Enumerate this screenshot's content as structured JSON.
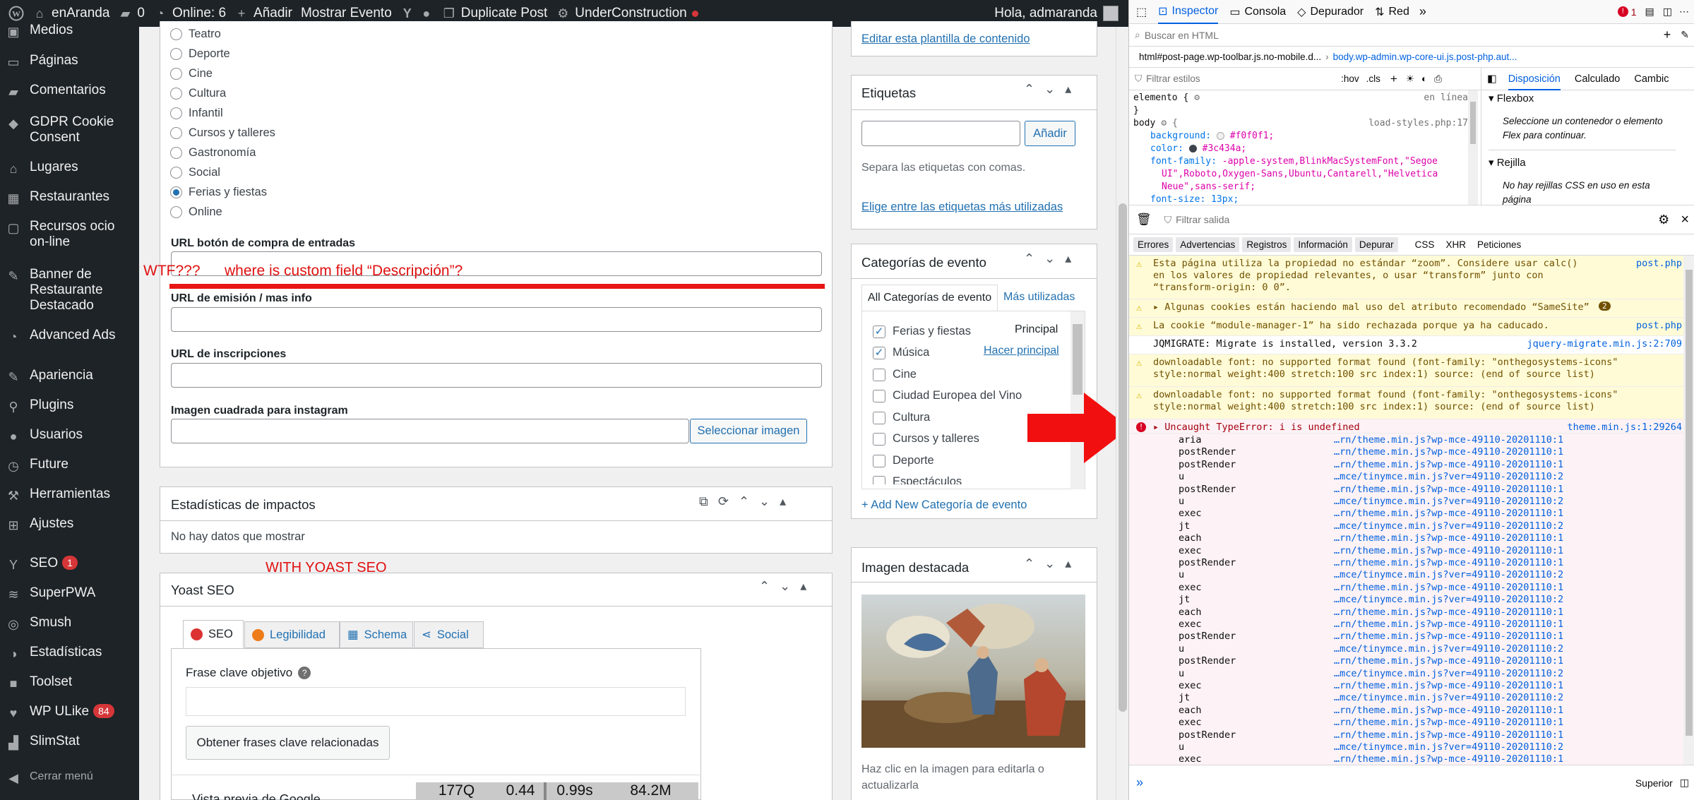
{
  "adminbar": {
    "site": "enAranda",
    "comments": "0",
    "online": "Online: 6",
    "add": "Añadir",
    "show_event": "Mostrar Evento",
    "duplicate": "Duplicate Post",
    "under_construction": "UnderConstruction",
    "greeting": "Hola, admaranda"
  },
  "sidebar": {
    "items": [
      {
        "label": "Medios",
        "icon": "media-icon"
      },
      {
        "label": "Páginas",
        "icon": "pages-icon"
      },
      {
        "label": "Comentarios",
        "icon": "comments-icon"
      },
      {
        "label": "GDPR Cookie Consent",
        "icon": "cookie-icon"
      },
      {
        "label": "Lugares",
        "icon": "places-icon"
      },
      {
        "label": "Restaurantes",
        "icon": "restaurant-icon"
      },
      {
        "label": "Recursos ocio on-line",
        "icon": "resources-icon"
      },
      {
        "label": "Banner de Restaurante Destacado",
        "icon": "banner-icon"
      },
      {
        "label": "Advanced Ads",
        "icon": "ads-icon"
      },
      {
        "label": "Apariencia",
        "icon": "appearance-icon"
      },
      {
        "label": "Plugins",
        "icon": "plugins-icon"
      },
      {
        "label": "Usuarios",
        "icon": "users-icon"
      },
      {
        "label": "Future",
        "icon": "future-icon"
      },
      {
        "label": "Herramientas",
        "icon": "tools-icon"
      },
      {
        "label": "Ajustes",
        "icon": "settings-icon"
      },
      {
        "label": "SEO",
        "icon": "yoast-icon",
        "badge": "1"
      },
      {
        "label": "SuperPWA",
        "icon": "pwa-icon"
      },
      {
        "label": "Smush",
        "icon": "smush-icon"
      },
      {
        "label": "Estadísticas",
        "icon": "stats-icon"
      },
      {
        "label": "Toolset",
        "icon": "toolset-icon"
      },
      {
        "label": "WP ULike",
        "icon": "ulike-icon",
        "badge": "84"
      },
      {
        "label": "SlimStat",
        "icon": "slimstat-icon"
      },
      {
        "label": "Cerrar menú",
        "icon": "collapse-icon"
      }
    ]
  },
  "radios": [
    "Teatro",
    "Deporte",
    "Cine",
    "Cultura",
    "Infantil",
    "Cursos y talleres",
    "Gastronomía",
    "Social",
    "Ferias y fiestas",
    "Online"
  ],
  "fields": {
    "buy_url": "URL botón de compra de entradas",
    "emission_url": "URL de emisión / mas info",
    "signup_url": "URL de inscripciones",
    "insta_image": "Imagen cuadrada para instagram",
    "select_image": "Seleccionar imagen"
  },
  "annotations": {
    "wtf": "WTF???",
    "missing": "where is custom field “Descripción”?",
    "yoast": "WITH YOAST SEO"
  },
  "stats": {
    "title": "Estadísticas de impactos",
    "empty": "No hay datos que mostrar"
  },
  "yoast": {
    "title": "Yoast SEO",
    "tabs": [
      "SEO",
      "Legibilidad",
      "Schema",
      "Social"
    ],
    "focus_label": "Frase clave objetivo",
    "related_button": "Obtener frases clave relacionadas",
    "preview": "Vista previa de Google",
    "metrics": [
      "177Q",
      "0.44",
      "0.99s",
      "84.2M"
    ]
  },
  "right": {
    "edit_template": "Editar esta plantilla de contenido",
    "tags_title": "Etiquetas",
    "add_button": "Añadir",
    "tags_hint": "Separa las etiquetas con comas.",
    "tags_link": "Elige entre las etiquetas más utilizadas",
    "cat_title": "Categorías de evento",
    "cat_tab_all": "All Categorías de evento",
    "cat_tab_used": "Más utilizadas",
    "categories": [
      {
        "label": "Ferias y fiestas",
        "checked": true,
        "extra": "Principal"
      },
      {
        "label": "Música",
        "checked": true,
        "extra": "Hacer principal"
      },
      {
        "label": "Cine",
        "checked": false
      },
      {
        "label": "Ciudad Europea del Vino",
        "checked": false
      },
      {
        "label": "Cultura",
        "checked": false
      },
      {
        "label": "Cursos y talleres",
        "checked": false
      },
      {
        "label": "Deporte",
        "checked": false
      },
      {
        "label": "Espectáculos",
        "checked": false
      }
    ],
    "add_cat": "+ Add New Categoría de evento",
    "featured_title": "Imagen destacada",
    "featured_hint": "Haz clic en la imagen para editarla o actualizarla"
  },
  "devtools": {
    "tabs": [
      "Inspector",
      "Consola",
      "Depurador",
      "Red"
    ],
    "error_count": "1",
    "search_html": "Buscar en HTML",
    "breadcrumb_left": "html#post-page.wp-toolbar.js.no-mobile.d...",
    "breadcrumb_right": "body.wp-admin.wp-core-ui.js.post-php.aut...",
    "filter_styles": "Filtrar estilos",
    "hov": ":hov",
    "cls": ".cls",
    "layout_tabs": [
      "Disposición",
      "Calculado",
      "Cambic"
    ],
    "css": {
      "rule1": "elemento {",
      "inline": "en línea",
      "close": "}",
      "rule2": "body",
      "source": "load-styles.php:17",
      "bg_prop": "background:",
      "bg_val": "#f0f0f1;",
      "color_prop": "color:",
      "color_val": "#3c434a;",
      "ff_prop": "font-family:",
      "ff_val1": "-apple-system,BlinkMacSystemFont,\"Segoe",
      "ff_val2": "UI\",Roboto,Oxygen-Sans,Ubuntu,Cantarell,\"Helvetica",
      "ff_val3": "Neue\",sans-serif;",
      "fs_line": "font-size: 13px;"
    },
    "flexbox": "Flexbox",
    "flex_hint": "Seleccione un contenedor o elemento Flex para continuar.",
    "grid": "Rejilla",
    "grid_hint": "No hay rejillas CSS en uso en esta página",
    "filter_output": "Filtrar salida",
    "console_filters": [
      "Errores",
      "Advertencias",
      "Registros",
      "Información",
      "Depurar",
      "CSS",
      "XHR",
      "Peticiones"
    ],
    "messages": [
      {
        "type": "warn",
        "text": "Esta página utiliza la propiedad no estándar “zoom”. Considere usar calc() en los valores de propiedad relevantes, o usar “transform” junto con “transform-origin: 0 0”.",
        "src": "post.php"
      },
      {
        "type": "warn",
        "text": "▸ Algunas cookies están haciendo mal uso del atributo recomendado “SameSite”",
        "src": "",
        "count": "2"
      },
      {
        "type": "warn",
        "text": "La cookie “module-manager-1” ha sido rechazada porque ya ha caducado.",
        "src": "post.php"
      },
      {
        "type": "log",
        "text": "JQMIGRATE: Migrate is installed, version 3.3.2",
        "src": "jquery-migrate.min.js:2:709"
      },
      {
        "type": "warn",
        "text": "downloadable font: no supported format found (font-family: \"onthegosystems-icons\" style:normal weight:400 stretch:100 src index:1) source: (end of source list)",
        "src": ""
      },
      {
        "type": "warn",
        "text": "downloadable font: no supported format found (font-family: \"onthegosystems-icons\" style:normal weight:400 stretch:100 src index:1) source: (end of source list)",
        "src": ""
      },
      {
        "type": "error",
        "text": "▸ Uncaught TypeError: i is undefined",
        "src": "theme.min.js:1:29264"
      }
    ],
    "trace": [
      [
        "aria",
        "…rn/theme.min.js?wp-mce-49110-20201110:1"
      ],
      [
        "postRender",
        "…rn/theme.min.js?wp-mce-49110-20201110:1"
      ],
      [
        "postRender",
        "…rn/theme.min.js?wp-mce-49110-20201110:1"
      ],
      [
        "u",
        "…mce/tinymce.min.js?ver=49110-20201110:2"
      ],
      [
        "postRender",
        "…rn/theme.min.js?wp-mce-49110-20201110:1"
      ],
      [
        "u",
        "…mce/tinymce.min.js?ver=49110-20201110:2"
      ],
      [
        "exec",
        "…rn/theme.min.js?wp-mce-49110-20201110:1"
      ],
      [
        "jt",
        "…mce/tinymce.min.js?ver=49110-20201110:2"
      ],
      [
        "each",
        "…rn/theme.min.js?wp-mce-49110-20201110:1"
      ],
      [
        "exec",
        "…rn/theme.min.js?wp-mce-49110-20201110:1"
      ],
      [
        "postRender",
        "…rn/theme.min.js?wp-mce-49110-20201110:1"
      ],
      [
        "u",
        "…mce/tinymce.min.js?ver=49110-20201110:2"
      ],
      [
        "exec",
        "…rn/theme.min.js?wp-mce-49110-20201110:1"
      ],
      [
        "jt",
        "…mce/tinymce.min.js?ver=49110-20201110:2"
      ],
      [
        "each",
        "…rn/theme.min.js?wp-mce-49110-20201110:1"
      ],
      [
        "exec",
        "…rn/theme.min.js?wp-mce-49110-20201110:1"
      ],
      [
        "postRender",
        "…rn/theme.min.js?wp-mce-49110-20201110:1"
      ],
      [
        "u",
        "…mce/tinymce.min.js?ver=49110-20201110:2"
      ],
      [
        "postRender",
        "…rn/theme.min.js?wp-mce-49110-20201110:1"
      ],
      [
        "u",
        "…mce/tinymce.min.js?ver=49110-20201110:2"
      ],
      [
        "exec",
        "…rn/theme.min.js?wp-mce-49110-20201110:1"
      ],
      [
        "jt",
        "…mce/tinymce.min.js?ver=49110-20201110:2"
      ],
      [
        "each",
        "…rn/theme.min.js?wp-mce-49110-20201110:1"
      ],
      [
        "exec",
        "…rn/theme.min.js?wp-mce-49110-20201110:1"
      ],
      [
        "postRender",
        "…rn/theme.min.js?wp-mce-49110-20201110:1"
      ],
      [
        "u",
        "…mce/tinymce.min.js?ver=49110-20201110:2"
      ],
      [
        "exec",
        "…rn/theme.min.js?wp-mce-49110-20201110:1"
      ]
    ],
    "position_label": "Superior"
  }
}
